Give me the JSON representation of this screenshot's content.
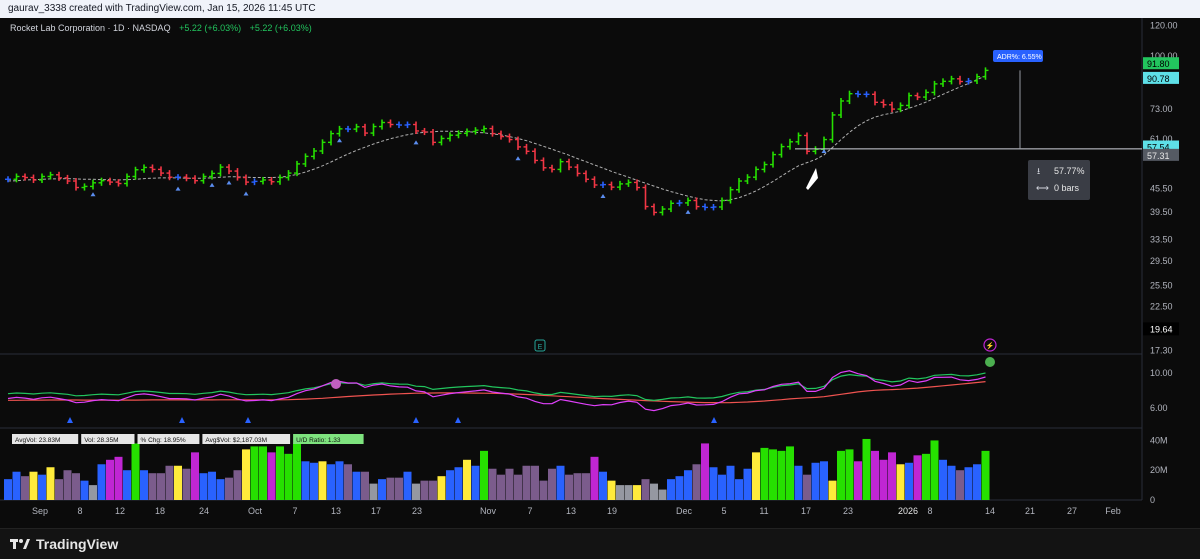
{
  "header": {
    "caption": "gaurav_3338 created with TradingView.com, Jan 15, 2026 11:45 UTC"
  },
  "legend": {
    "symbol": "Rocket Lab Corporation · 1D · NASDAQ",
    "change1": "+5.22 (+6.03%)",
    "change2": "+5.22 (+6.03%)"
  },
  "branding": {
    "name": "TradingView"
  },
  "colors": {
    "up": "#26e000",
    "down": "#f23645",
    "neutral": "#2962ff",
    "ma": "#cccccc",
    "ind1": "#22c55e",
    "ind2": "#e040fb",
    "ind3": "#ef5350"
  },
  "icons": {
    "earnings": "earnings-e-icon",
    "dividend": "lightning-icon",
    "logo": "tradingview-logo-icon"
  },
  "chart_data": [
    {
      "type": "candlestick",
      "title": "Rocket Lab Corporation · 1D · NASDAQ",
      "yscale": "log",
      "ylim": [
        17.3,
        120.0
      ],
      "y_ticks": [
        "120.00",
        "100.00",
        "73.00",
        "61.00",
        "45.50",
        "39.50",
        "33.50",
        "29.50",
        "25.50",
        "22.50",
        "19.64",
        "17.30"
      ],
      "x_ticks": [
        "Sep",
        "8",
        "12",
        "18",
        "24",
        "Oct",
        "7",
        "13",
        "17",
        "23",
        "Nov",
        "7",
        "13",
        "19",
        "Dec",
        "5",
        "11",
        "17",
        "23",
        "2026",
        "8",
        "14",
        "21",
        "27",
        "Feb"
      ],
      "price_labels": {
        "last": "91.80",
        "ma": "90.78",
        "level": "57.54",
        "level2": "57.31",
        "low_marker": "19.64"
      },
      "annotations": {
        "adr": "ADR%: 6.55%",
        "measure_pct": "57.77%",
        "measure_bars": "0 bars"
      },
      "close": [
        48.0,
        48.8,
        48.5,
        47.8,
        48.8,
        49.3,
        48.4,
        47.5,
        45.7,
        46.0,
        47.0,
        47.6,
        47.2,
        46.8,
        48.8,
        50.8,
        51.5,
        50.9,
        49.8,
        48.6,
        48.6,
        48.3,
        47.6,
        48.8,
        49.7,
        51.6,
        50.4,
        48.5,
        47.2,
        47.4,
        47.8,
        47.3,
        48.5,
        49.8,
        52.6,
        55.0,
        56.8,
        59.8,
        63.0,
        64.8,
        64.7,
        65.6,
        63.2,
        65.7,
        67.3,
        66.5,
        66.3,
        66.5,
        64.0,
        63.6,
        59.8,
        61.2,
        62.4,
        63.1,
        63.8,
        64.3,
        64.9,
        63.0,
        61.9,
        60.8,
        58.2,
        56.7,
        53.7,
        51.4,
        50.9,
        53.3,
        51.6,
        49.7,
        48.0,
        46.4,
        46.5,
        45.8,
        46.7,
        47.1,
        45.7,
        40.8,
        39.4,
        40.2,
        41.6,
        41.7,
        42.3,
        40.8,
        40.6,
        40.7,
        42.3,
        45.1,
        47.5,
        48.6,
        50.9,
        52.4,
        55.6,
        58.3,
        60.0,
        62.3,
        56.7,
        57.4,
        60.8,
        70.4,
        76.5,
        79.9,
        79.6,
        79.6,
        75.9,
        74.8,
        72.9,
        74.5,
        79.0,
        78.3,
        80.5,
        84.7,
        86.0,
        87.3,
        85.9,
        86.2,
        88.4,
        91.8
      ],
      "ma": [
        47.5,
        47.6,
        47.8,
        47.9,
        48.0,
        48.1,
        48.1,
        48.2,
        48.1,
        48.0,
        48.0,
        47.9,
        47.9,
        47.8,
        47.9,
        48.0,
        48.2,
        48.3,
        48.4,
        48.4,
        48.4,
        48.3,
        48.3,
        48.3,
        48.4,
        48.6,
        48.7,
        48.7,
        48.6,
        48.5,
        48.5,
        48.5,
        48.6,
        48.9,
        49.4,
        50.1,
        51.0,
        52.0,
        53.2,
        54.5,
        55.8,
        57.0,
        58.1,
        59.2,
        60.2,
        61.1,
        61.9,
        62.6,
        63.1,
        63.5,
        63.7,
        63.9,
        63.9,
        63.8,
        63.7,
        63.5,
        63.3,
        62.9,
        62.5,
        61.9,
        61.2,
        60.4,
        59.4,
        58.4,
        57.4,
        56.4,
        55.4,
        54.3,
        53.3,
        52.3,
        51.3,
        50.3,
        49.4,
        48.6,
        47.7,
        46.9,
        46.1,
        45.3,
        44.6,
        44.0,
        43.4,
        42.9,
        42.5,
        42.3,
        42.2,
        42.5,
        43.0,
        43.8,
        44.8,
        46.0,
        47.4,
        48.9,
        50.5,
        52.0,
        53.0,
        54.0,
        55.5,
        58.0,
        60.8,
        63.5,
        66.0,
        68.0,
        69.5,
        70.5,
        71.2,
        72.0,
        73.3,
        74.5,
        76.0,
        77.8,
        79.6,
        81.4,
        83.2,
        84.9,
        86.9,
        88.8
      ]
    },
    {
      "type": "line",
      "y_ticks": [
        "10.00",
        "6.00"
      ],
      "series": []
    },
    {
      "type": "bar",
      "y_ticks": [
        "40M",
        "20M",
        "0"
      ],
      "stats": [
        "AvgVol: 23.83M",
        "Vol: 28.35M",
        "% Chg: 18.95%",
        "Avg$Vol: $2,187.03M",
        "U/D Ratio: 1.33"
      ],
      "values": [
        14,
        19,
        16,
        19,
        17,
        22,
        14,
        20,
        18,
        13,
        10,
        24,
        27,
        29,
        20,
        38,
        20,
        18,
        18,
        23,
        23,
        21,
        32,
        18,
        19,
        14,
        15,
        20,
        34,
        36,
        36,
        32,
        36,
        31,
        38,
        26,
        25,
        26,
        24,
        26,
        24,
        19,
        19,
        11,
        14,
        15,
        15,
        19,
        11,
        13,
        13,
        16,
        20,
        22,
        27,
        23,
        33,
        21,
        17,
        21,
        17,
        23,
        23,
        13,
        21,
        23,
        17,
        18,
        18,
        29,
        19,
        13,
        10,
        10,
        10,
        14,
        11,
        7,
        14,
        16,
        20,
        24,
        38,
        22,
        17,
        23,
        14,
        21,
        32,
        35,
        34,
        33,
        36,
        23,
        17,
        25,
        26,
        13,
        33,
        34,
        26,
        41,
        33,
        27,
        32,
        24,
        25,
        30,
        31,
        40,
        27,
        23,
        20,
        22,
        24,
        33
      ]
    }
  ]
}
